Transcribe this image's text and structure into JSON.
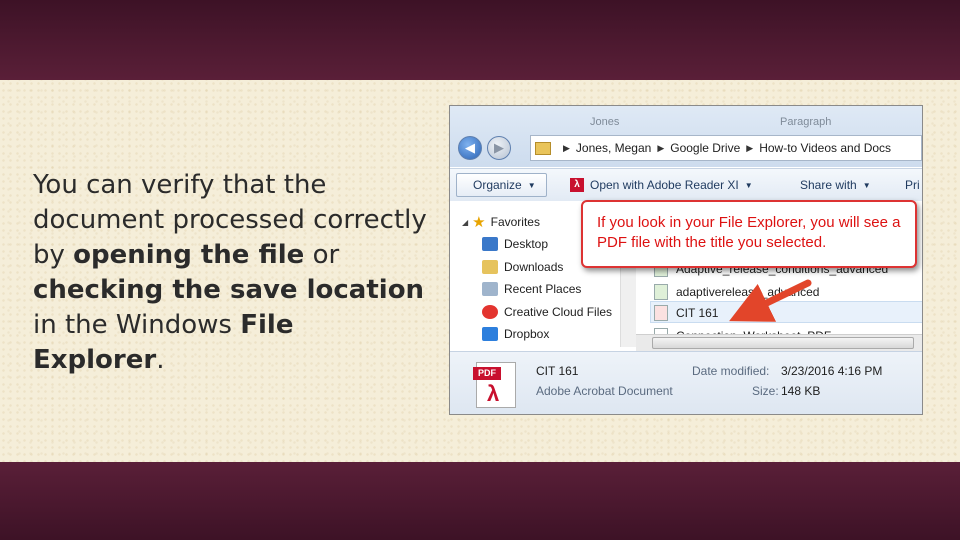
{
  "slide": {
    "text_parts": {
      "p1": "You can verify that the document processed correctly by ",
      "b1": "opening the file",
      "p2": " or ",
      "b2": "checking the save location",
      "p3": " in the Windows ",
      "b3": "File Explorer",
      "p4": "."
    }
  },
  "explorer": {
    "ghost_titles": [
      "Jones",
      "Paragraph"
    ],
    "breadcrumbs": [
      "Jones, Megan",
      "Google Drive",
      "How-to Videos and Docs"
    ],
    "toolbar": {
      "organize": "Organize",
      "open_with": "Open with Adobe Reader XI",
      "share_with": "Share with",
      "print": "Pri"
    },
    "favorites_label": "Favorites",
    "nav_items": [
      "Desktop",
      "Downloads",
      "Recent Places",
      "Creative Cloud Files",
      "Dropbox"
    ],
    "files": [
      "Adaptive_release_conditions_advanced",
      "adaptiverelease_advanced",
      "CIT 161",
      "Connection_Worksheet_PDF"
    ],
    "details": {
      "name": "CIT 161",
      "type": "Adobe Acrobat Document",
      "date_label": "Date modified:",
      "date_value": "3/23/2016 4:16 PM",
      "size_label": "Size:",
      "size_value": "148 KB"
    }
  },
  "callout": {
    "text": "If you look in your File Explorer, you will see a PDF file with the title you selected."
  },
  "colors": {
    "band": "#4a1830",
    "callout_red": "#dd1111",
    "parchment": "#f5eed9"
  },
  "icons": [
    "back-arrow-icon",
    "forward-arrow-icon",
    "folder-icon",
    "pdf-icon",
    "star-icon",
    "desktop-icon",
    "downloads-icon",
    "recent-places-icon",
    "creative-cloud-icon",
    "dropbox-icon",
    "red-arrow-icon"
  ]
}
